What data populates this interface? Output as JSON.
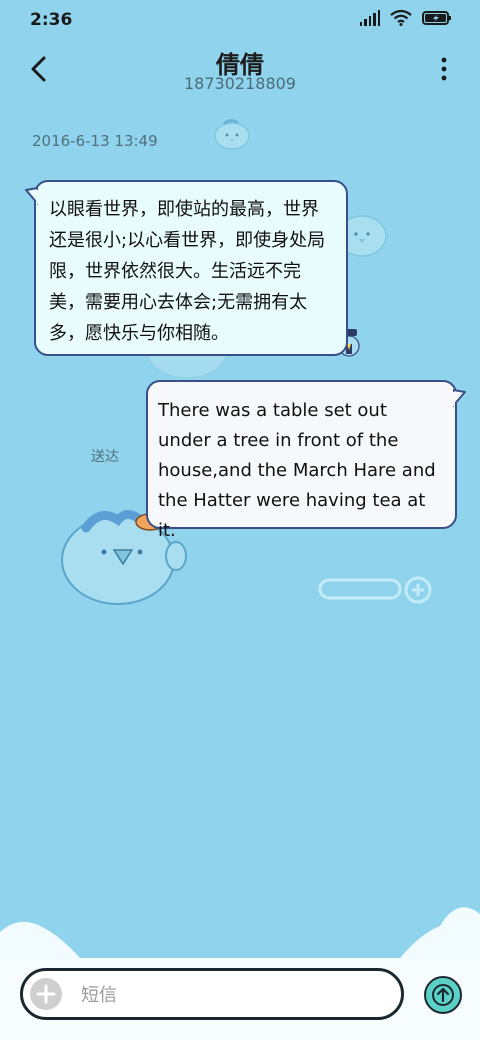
{
  "status_bar": {
    "time": "2:36",
    "icons": [
      "signal-icon",
      "wifi-icon",
      "battery-charging-icon"
    ]
  },
  "header": {
    "contact_name": "倩倩",
    "contact_number": "18730218809",
    "back_icon": "back-arrow-icon",
    "more_icon": "more-vertical-icon"
  },
  "conversation": {
    "timestamp": "2016-6-13 13:49",
    "messages": [
      {
        "direction": "incoming",
        "text": "以眼看世界，即使站的最高，世界还是很小;以心看世界，即使身处局限，世界依然很大。生活远不完美，需要用心去体会;无需拥有太多，愿快乐与你相随。"
      },
      {
        "direction": "outgoing",
        "text": "There was a table set out under a tree in front of the house,and the March Hare and the Hatter were having tea at it."
      }
    ],
    "delivery_status": "送达"
  },
  "composer": {
    "placeholder": "短信",
    "value": "",
    "add_icon": "plus-icon",
    "send_icon": "send-arrow-up-icon"
  },
  "theme": {
    "background": "#8fd3ec",
    "bubble_border": "#3a4f87",
    "incoming_bubble": "#e8fbfd",
    "outgoing_bubble": "#f7f8fc",
    "send_button": "#5ad0c6"
  }
}
